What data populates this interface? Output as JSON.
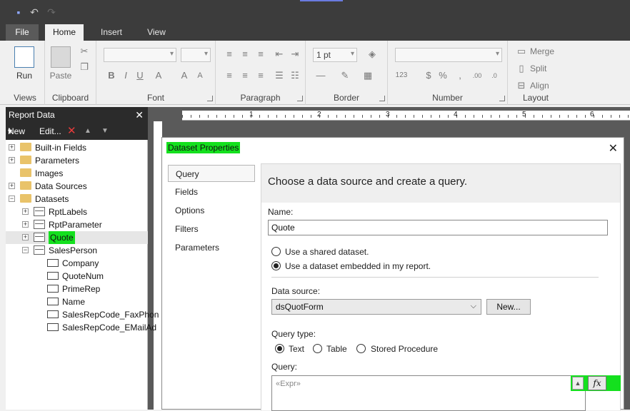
{
  "ribbon": {
    "tabs": [
      "File",
      "Home",
      "Insert",
      "View"
    ],
    "groups": {
      "views": {
        "label": "Views",
        "run": "Run"
      },
      "clipboard": {
        "label": "Clipboard",
        "paste": "Paste"
      },
      "font": {
        "label": "Font"
      },
      "paragraph": {
        "label": "Paragraph"
      },
      "border": {
        "label": "Border",
        "width": "1 pt"
      },
      "number": {
        "label": "Number"
      },
      "layout": {
        "label": "Layout",
        "merge": "Merge",
        "split": "Split",
        "align": "Align"
      }
    }
  },
  "report_data": {
    "title": "Report Data",
    "new": "New",
    "edit": "Edit...",
    "tree": [
      {
        "label": "Built-in Fields",
        "type": "folder",
        "exp": "+"
      },
      {
        "label": "Parameters",
        "type": "folder",
        "exp": "+"
      },
      {
        "label": "Images",
        "type": "folder",
        "exp": ""
      },
      {
        "label": "Data Sources",
        "type": "folder",
        "exp": "+"
      },
      {
        "label": "Datasets",
        "type": "folder",
        "exp": "−"
      },
      {
        "label": "RptLabels",
        "type": "dataset",
        "exp": "+"
      },
      {
        "label": "RptParameter",
        "type": "dataset",
        "exp": "+"
      },
      {
        "label": "Quote",
        "type": "dataset",
        "exp": "+"
      },
      {
        "label": "SalesPerson",
        "type": "dataset",
        "exp": "−"
      },
      {
        "label": "Company",
        "type": "field",
        "exp": ""
      },
      {
        "label": "QuoteNum",
        "type": "field",
        "exp": ""
      },
      {
        "label": "PrimeRep",
        "type": "field",
        "exp": ""
      },
      {
        "label": "Name",
        "type": "field",
        "exp": ""
      },
      {
        "label": "SalesRepCode_FaxPhon",
        "type": "field",
        "exp": ""
      },
      {
        "label": "SalesRepCode_EMailAd",
        "type": "field",
        "exp": ""
      }
    ]
  },
  "ruler": [
    "1",
    "2",
    "3",
    "4",
    "5",
    "6"
  ],
  "dialog": {
    "title": "Dataset Properties",
    "nav": [
      "Query",
      "Fields",
      "Options",
      "Filters",
      "Parameters"
    ],
    "header": "Choose a data source and create a query.",
    "name_label": "Name:",
    "name_value": "Quote",
    "opt_shared": "Use a shared dataset.",
    "opt_embedded": "Use a dataset embedded in my report.",
    "datasource_label": "Data source:",
    "datasource_value": "dsQuotForm",
    "new_button": "New...",
    "querytype_label": "Query type:",
    "qt_text": "Text",
    "qt_table": "Table",
    "qt_sp": "Stored Procedure",
    "query_label": "Query:",
    "query_placeholder": "«Expr»",
    "fx": "fx"
  }
}
